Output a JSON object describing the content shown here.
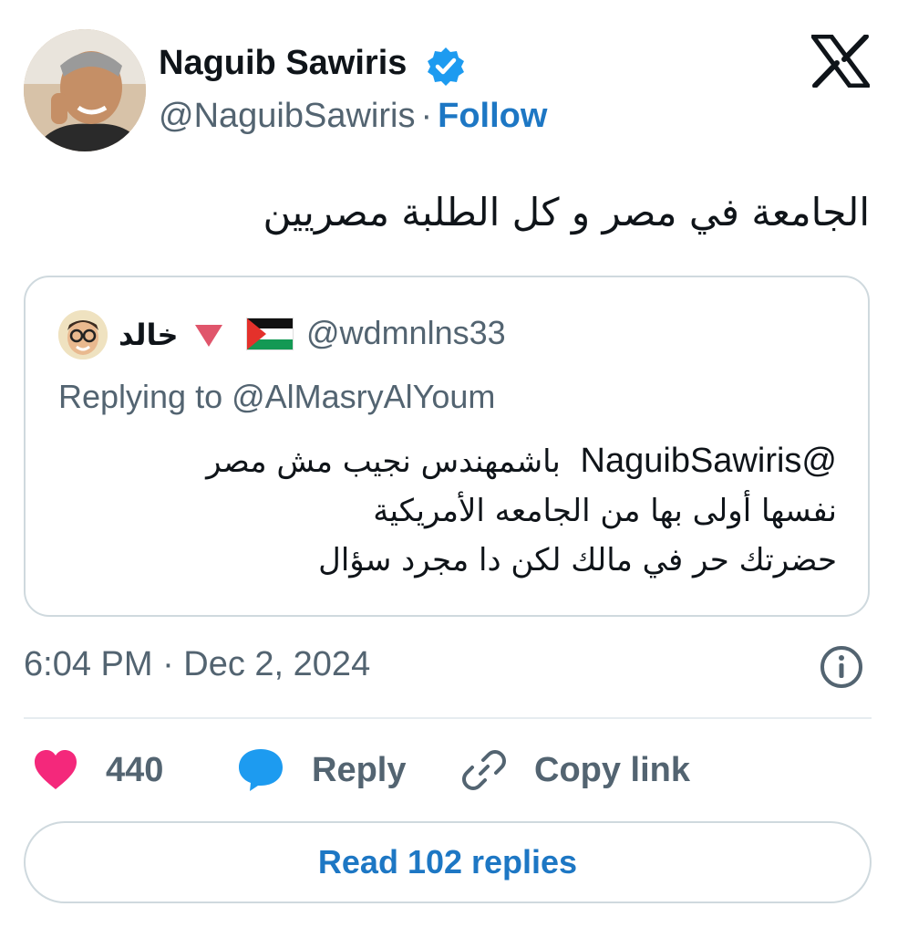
{
  "author": {
    "display_name": "Naguib Sawiris",
    "handle": "@NaguibSawiris",
    "separator": "·",
    "follow_label": "Follow",
    "verified": true
  },
  "tweet": {
    "text": "الجامعة في مصر و كل الطلبة مصريين"
  },
  "quoted": {
    "name": "خالد",
    "handle": "@wdmnlns33",
    "replying_to": "Replying to @AlMasryAlYoum",
    "mention": "@NaguibSawiris",
    "line1_rest": "باشمهندس نجيب مش مصر",
    "line2": "نفسها أولى بها من الجامعه الأمريكية",
    "line3": "حضرتك حر في مالك لكن دا مجرد سؤال"
  },
  "timestamp": "6:04 PM · Dec 2, 2024",
  "actions": {
    "like_count": "440",
    "reply_label": "Reply",
    "copy_link_label": "Copy link"
  },
  "read_replies_label": "Read 102 replies",
  "colors": {
    "link_blue": "#1d77c4",
    "verified_blue": "#1d9bf0",
    "like_pink": "#f4287b",
    "secondary_text": "#536471",
    "border": "#cfd9de"
  },
  "icons": [
    "verified-badge-icon",
    "x-logo-icon",
    "triangle-down-icon",
    "palestine-flag-icon",
    "info-icon",
    "heart-icon",
    "speech-bubble-icon",
    "link-icon"
  ]
}
